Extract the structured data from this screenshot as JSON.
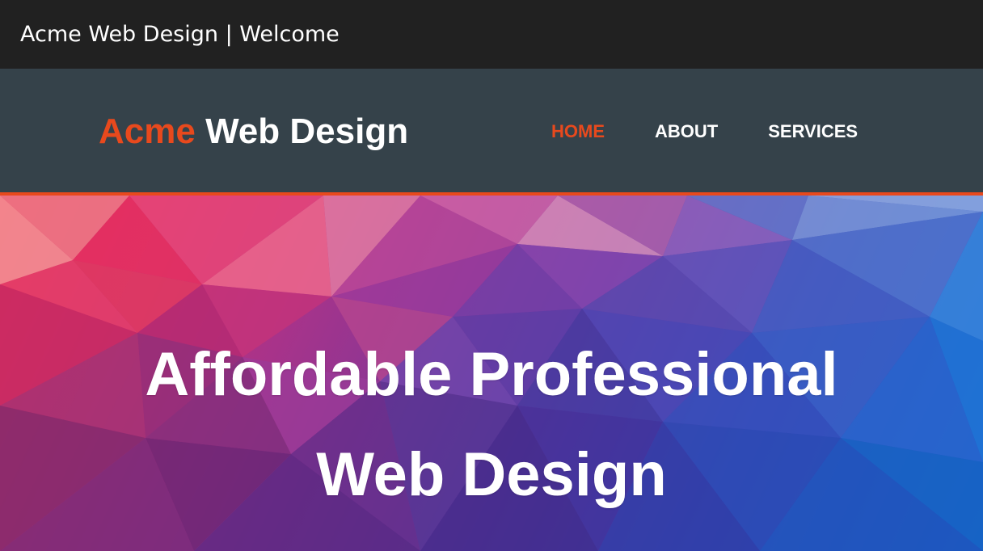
{
  "window": {
    "title": "Acme Web Design | Welcome"
  },
  "header": {
    "logo_highlight": "Acme",
    "logo_rest": " Web Design",
    "nav": [
      {
        "label": "HOME",
        "current": true
      },
      {
        "label": "ABOUT",
        "current": false
      },
      {
        "label": "SERVICES",
        "current": false
      }
    ]
  },
  "showcase": {
    "heading_line1": "Affordable Professional",
    "heading_line2": "Web Design"
  },
  "colors": {
    "accent": "#e8491d",
    "header_bg": "#35424a",
    "titlebar_bg": "#212121"
  }
}
